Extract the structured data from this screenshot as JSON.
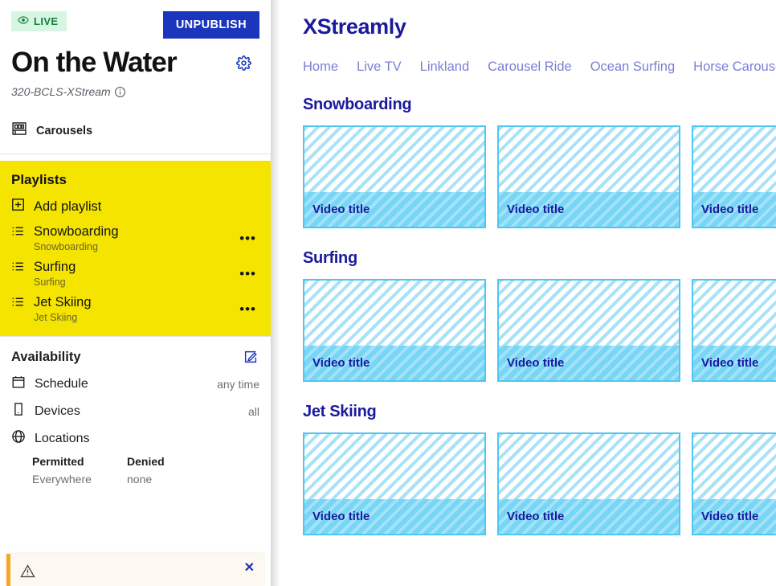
{
  "sidebar": {
    "status_badge": {
      "label": "LIVE",
      "icon": "eye-icon",
      "bg": "#d7f5e3",
      "fg": "#15803d"
    },
    "unpublish_label": "UNPUBLISH",
    "page_title": "On the Water",
    "reference_id": "320-BCLS-XStream",
    "info_icon": "info-icon",
    "gear_icon": "gear-icon",
    "carousels": {
      "label": "Carousels",
      "icon": "carousels-icon"
    },
    "playlists": {
      "heading": "Playlists",
      "bg": "#f5e400",
      "add_label": "Add playlist",
      "add_icon": "plus-box-icon",
      "items": [
        {
          "name": "Snowboarding",
          "sub": "Snowboarding",
          "icon": "list-icon",
          "menu": "•••"
        },
        {
          "name": "Surfing",
          "sub": "Surfing",
          "icon": "list-icon",
          "menu": "•••"
        },
        {
          "name": "Jet Skiing",
          "sub": "Jet Skiing",
          "icon": "list-icon",
          "menu": "•••"
        }
      ]
    },
    "availability": {
      "title": "Availability",
      "edit_icon": "edit-pencil-icon",
      "rows": [
        {
          "label": "Schedule",
          "value": "any time",
          "icon": "calendar-icon"
        },
        {
          "label": "Devices",
          "value": "all",
          "icon": "device-icon"
        }
      ],
      "locations": {
        "label": "Locations",
        "icon": "globe-icon",
        "permitted_header": "Permitted",
        "permitted_value": "Everywhere",
        "denied_header": "Denied",
        "denied_value": "none"
      }
    },
    "toast": {
      "icon": "warning-triangle-icon",
      "close_icon": "✕",
      "accent": "#f5a623",
      "bg": "#fdf8f0"
    }
  },
  "preview": {
    "brand": "XStreamly",
    "brand_color": "#1a1a9e",
    "nav": [
      {
        "label": "Home"
      },
      {
        "label": "Live TV"
      },
      {
        "label": "Linkland"
      },
      {
        "label": "Carousel Ride"
      },
      {
        "label": "Ocean Surfing"
      },
      {
        "label": "Horse Carousel"
      },
      {
        "label": "·"
      }
    ],
    "card_title": "Video title",
    "sections": [
      {
        "title": "Snowboarding",
        "cards": [
          "Video title",
          "Video title",
          "Video title"
        ]
      },
      {
        "title": "Surfing",
        "cards": [
          "Video title",
          "Video title",
          "Video title"
        ]
      },
      {
        "title": "Jet Skiing",
        "cards": [
          "Video title",
          "Video title",
          "Video title"
        ]
      }
    ]
  }
}
